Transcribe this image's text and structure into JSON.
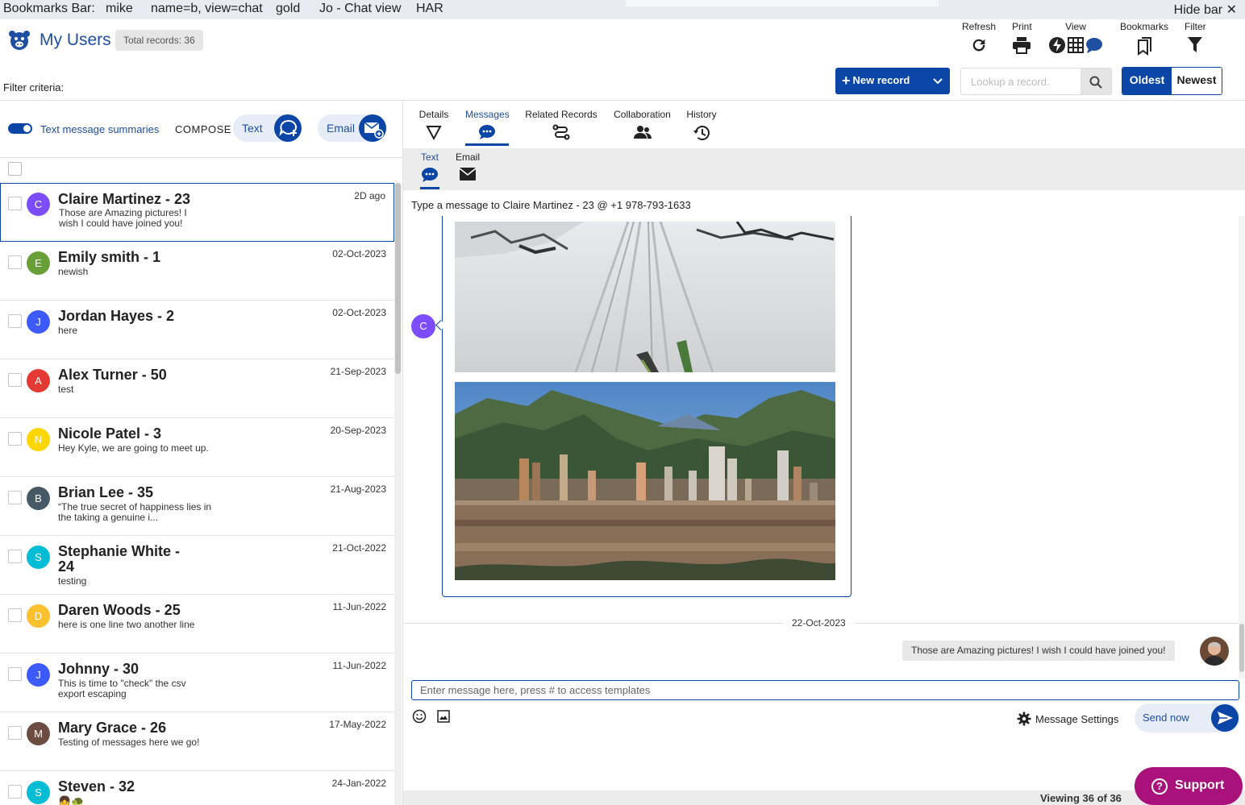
{
  "bookmarks_bar": {
    "title": "Bookmarks Bar:",
    "items": [
      "mike",
      "name=b, view=chat",
      "gold",
      "Jo - Chat view",
      "HAR"
    ],
    "hide_label": "Hide bar",
    "close_glyph": "✕"
  },
  "header": {
    "title": "My Users",
    "total_records": "Total records: 36",
    "filter_criteria": "Filter criteria:",
    "logo_icon": "pig-icon"
  },
  "toolbar": {
    "refresh": "Refresh",
    "print": "Print",
    "view": "View",
    "bookmarks": "Bookmarks",
    "filter": "Filter"
  },
  "actions": {
    "new_record": "New record",
    "lookup_placeholder": "Lookup a record.",
    "oldest": "Oldest",
    "newest": "Newest"
  },
  "left": {
    "summaries_label": "Text message summaries",
    "compose_label": "COMPOSE",
    "text_button": "Text",
    "email_button": "Email"
  },
  "contacts": [
    {
      "initial": "C",
      "color": "#7c4dff",
      "name": "Claire Martinez - 23",
      "preview": "Those are Amazing pictures! I wish I could have joined you!",
      "date": "2D ago",
      "selected": true
    },
    {
      "initial": "E",
      "color": "#689f38",
      "name": "Emily smith - 1",
      "preview": "newish",
      "date": "02-Oct-2023"
    },
    {
      "initial": "J",
      "color": "#3d5afe",
      "name": "Jordan Hayes - 2",
      "preview": "here",
      "date": "02-Oct-2023"
    },
    {
      "initial": "A",
      "color": "#e53935",
      "name": "Alex Turner - 50",
      "preview": "test",
      "date": "21-Sep-2023"
    },
    {
      "initial": "N",
      "color": "#ffd600",
      "name": "Nicole Patel - 3",
      "preview": "Hey Kyle, we are going to meet up.",
      "date": "20-Sep-2023"
    },
    {
      "initial": "B",
      "color": "#455a64",
      "name": "Brian Lee - 35",
      "preview": "“The true secret of happiness lies in the taking a genuine i...",
      "date": "21-Aug-2023"
    },
    {
      "initial": "S",
      "color": "#00bcd4",
      "name": "Stephanie White - 24",
      "preview": "testing",
      "date": "21-Oct-2022"
    },
    {
      "initial": "D",
      "color": "#fbc02d",
      "name": "Daren Woods - 25",
      "preview": "here is one line two another line",
      "date": "11-Jun-2022"
    },
    {
      "initial": "J",
      "color": "#3d5afe",
      "name": "Johnny - 30",
      "preview": "This is time to \"check\" the csv export escaping",
      "date": "11-Jun-2022"
    },
    {
      "initial": "M",
      "color": "#6d4c41",
      "name": "Mary Grace - 26",
      "preview": "Testing of messages here we go!",
      "date": "17-May-2022"
    },
    {
      "initial": "S",
      "color": "#00bcd4",
      "name": "Steven - 32",
      "preview": "👧🐢",
      "date": "24-Jan-2022"
    }
  ],
  "tabs": [
    {
      "label": "Details",
      "icon": "funnel-outline-icon"
    },
    {
      "label": "Messages",
      "icon": "chat-bubble-icon",
      "active": true
    },
    {
      "label": "Related Records",
      "icon": "route-icon"
    },
    {
      "label": "Collaboration",
      "icon": "people-icon"
    },
    {
      "label": "History",
      "icon": "history-icon"
    }
  ],
  "subtabs": [
    {
      "label": "Text",
      "icon": "chat-bubble-icon",
      "active": true
    },
    {
      "label": "Email",
      "icon": "envelope-icon"
    }
  ],
  "conversation": {
    "typing_to": "Type a message to Claire Martinez - 23 @ +1 978-793-1633",
    "sender_initial": "C",
    "date_separator": "22-Oct-2023",
    "outgoing_message": "Those are Amazing pictures! I wish I could have joined you!"
  },
  "composer": {
    "placeholder": "Enter message here, press # to access templates",
    "settings_label": "Message Settings",
    "send_label": "Send now"
  },
  "footer": {
    "viewing": "Viewing 36 of 36",
    "support": "Support"
  },
  "colors": {
    "primary": "#0b45a5",
    "support": "#a8127a"
  }
}
